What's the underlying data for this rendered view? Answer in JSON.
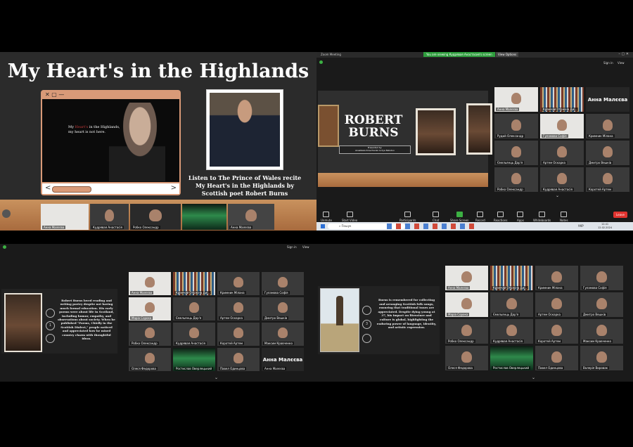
{
  "slide": {
    "title": "My Heart's in the Highlands",
    "caption": "Listen to The Prince of Wales recite My Heart's in the Highlands by Scottish poet Robert Burns",
    "video_text_white1": "My ",
    "video_text_red": "Heart's",
    "video_text_white2": " in the Highlands,",
    "video_text_line2": "my heart is not here.",
    "nav_prev": "<",
    "nav_next": ">"
  },
  "zoom_app": {
    "app_name": "Zoom Meeting",
    "sharing_banner": "You are viewing Кудрявая Анастасия's screen",
    "view_options": "View Options",
    "sign_in": "Sign in",
    "view": "View",
    "slide_title_1": "ROBERT",
    "slide_title_2": "BURNS",
    "slide_presented_by": "Presented by:",
    "slide_presenters": "Anastasia Kravchenko & Ilya Nikodov",
    "leave": "Leave",
    "toolbar": [
      "Unmute",
      "Start Video",
      "Participants",
      "Chat",
      "Share Screen",
      "Record",
      "Reactions",
      "Apps",
      "Whiteboards",
      "Notes"
    ],
    "participants_count": "31"
  },
  "taskbar": {
    "search": "Пошук",
    "time": "12:41",
    "date": "12.02.2024",
    "lang": "УКР"
  },
  "gallery_top": {
    "named_tile": "Анна Малєєва",
    "tiles": [
      "Анна Малєєва",
      "Крамчай Отрікіна Ди…",
      "Кримник Мілана",
      "Рудий Олександр",
      "Гуламова Софія",
      "Маріа Коваль",
      "Ємельянць Дар'я",
      "Артем Оскарка",
      "Дмитро Вешків",
      "Робко Олександр",
      "Кудрявая Анастасія",
      "Коротей Артем"
    ]
  },
  "bottom_left": {
    "sign_in": "Sign in",
    "view": "View",
    "text": "Robert Burns loved reading and writing poetry despite not having much formal education. His early poems were about life in Scotland, including humor, empathy, and observations about society. When he published \"Poems, Chiefly in the Scottish Dialect,\" people noticed and appreciated how he mixed country charm with thoughtful ideas.",
    "circle_num": "1",
    "named_tile": "Анна Малєєва",
    "tiles": [
      "Анна Малєєва",
      "Крамчай Отрікіна Ди…",
      "Кримник Мілана",
      "Гуламова Софія",
      "Маріа Сорока",
      "Ємельянць Дар'я",
      "Артем Оскарка",
      "Дмитро Вешків",
      "Робко Олександр",
      "Кудрявая Анастасія",
      "Коротей Артем",
      "Максим Кравченко",
      "Олеся Федорова",
      "Ростислав Оверлецький",
      "Павел Одинцова",
      "Анна Малєєва"
    ]
  },
  "bottom_right": {
    "text": "Burns is remembered for collecting and arranging Scottish folk songs, ensuring that traditional tunes are appreciated. Despite dying young at 37, his impact on literature and culture is global, highlighting the enduring power of language, identity, and artistic expression.",
    "circle_num": "3",
    "tiles": [
      "Анна Малєєва",
      "Крамчай Отрікіна Ди…",
      "Кримник Мілана",
      "Гуламова Софія",
      "Маріа Сорока",
      "Ємельянць Дар'я",
      "Артем Оскарка",
      "Дмитро Вешків",
      "Робко Олександр",
      "Кудрявая Анастасія",
      "Коротей Артем",
      "Максим Кравченко",
      "Олеся Федорова",
      "Ростислав Оверлецький",
      "Павел Одинцова",
      "Валерія Вировак"
    ]
  },
  "filmstrip_top_left": [
    "Анна Малєєва",
    "Кудрявая Анастасія",
    "Робко Олександр",
    "",
    "Анна Малєєва"
  ]
}
